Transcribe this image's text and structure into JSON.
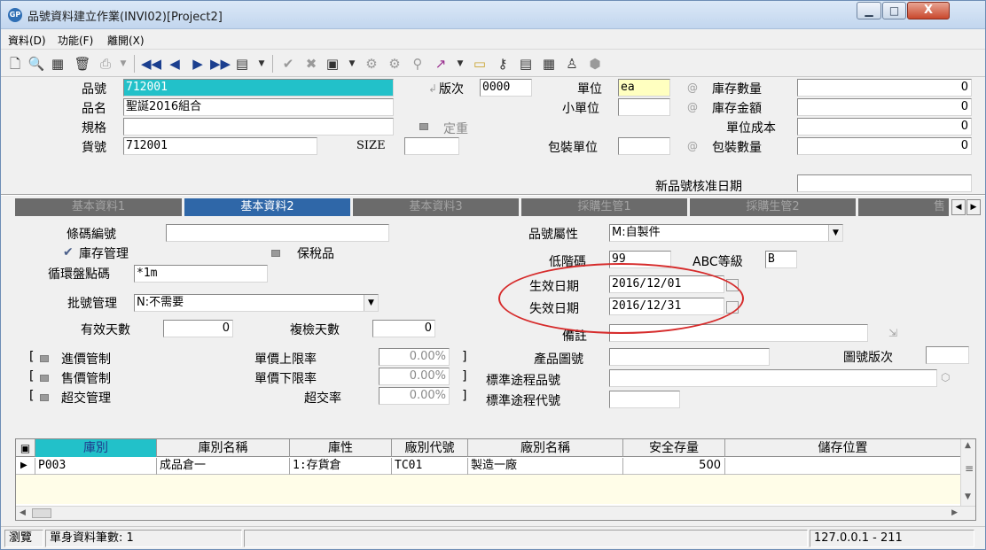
{
  "window": {
    "title": "品號資料建立作業(INVI02)[Project2]",
    "app_icon_text": "GP"
  },
  "menu": {
    "file": "資料(D)",
    "function": "功能(F)",
    "exit": "離開(X)"
  },
  "header": {
    "item_no_label": "品號",
    "item_no_value": "712001",
    "version_label": "版次",
    "version_value": "0000",
    "unit_label": "單位",
    "unit_value": "ea",
    "stock_qty_label": "庫存數量",
    "stock_qty_value": "0",
    "item_name_label": "品名",
    "item_name_value": "聖誕2016組合",
    "small_unit_label": "小單位",
    "small_unit_value": "",
    "stock_amount_label": "庫存金額",
    "stock_amount_value": "0",
    "spec_label": "規格",
    "spec_value": "",
    "fixed_weight_label": "定重",
    "unit_cost_label": "單位成本",
    "unit_cost_value": "0",
    "goods_no_label": "貨號",
    "goods_no_value": "712001",
    "size_label": "SIZE",
    "size_value": "",
    "pack_unit_label": "包裝單位",
    "pack_unit_value": "",
    "pack_qty_label": "包裝數量",
    "pack_qty_value": "0",
    "approve_date_label": "新品號核准日期",
    "approve_date_value": ""
  },
  "tabs": [
    {
      "label": "基本資料1"
    },
    {
      "label": "基本資料2"
    },
    {
      "label": "基本資料3"
    },
    {
      "label": "採購生管1"
    },
    {
      "label": "採購生管2"
    },
    {
      "label": "售"
    }
  ],
  "tab2": {
    "barcode_label": "條碼編號",
    "barcode_value": "",
    "inventory_mgmt_label": "庫存管理",
    "bonded_label": "保稅品",
    "cycle_count_label": "循環盤點碼",
    "cycle_count_value": "*1m",
    "lot_mgmt_label": "批號管理",
    "lot_mgmt_value": "N:不需要",
    "valid_days_label": "有效天數",
    "valid_days_value": "0",
    "recheck_days_label": "複檢天數",
    "recheck_days_value": "0",
    "purchase_ctrl_label": "進價管制",
    "sale_ctrl_label": "售價管制",
    "over_ctrl_label": "超交管理",
    "price_upper_label": "單價上限率",
    "price_upper_value": "0.00%",
    "price_lower_label": "單價下限率",
    "price_lower_value": "0.00%",
    "over_rate_label": "超交率",
    "over_rate_value": "0.00%",
    "attribute_label": "品號屬性",
    "attribute_value": "M:自製件",
    "low_level_label": "低階碼",
    "low_level_value": "99",
    "abc_label": "ABC等級",
    "abc_value": "B",
    "effective_date_label": "生效日期",
    "effective_date_value": "2016/12/01",
    "expiry_date_label": "失效日期",
    "expiry_date_value": "2016/12/31",
    "remark_label": "備註",
    "remark_value": "",
    "drawing_no_label": "產品圖號",
    "drawing_no_value": "",
    "drawing_ver_label": "圖號版次",
    "drawing_ver_value": "",
    "route_item_label": "標準途程品號",
    "route_item_value": "",
    "route_code_label": "標準途程代號",
    "route_code_value": "",
    "bracket_open": "[",
    "bracket_close": "]"
  },
  "grid": {
    "headers": [
      "庫別",
      "庫別名稱",
      "庫性",
      "廠別代號",
      "廠別名稱",
      "安全存量",
      "儲存位置"
    ],
    "rows": [
      {
        "warehouse": "P003",
        "warehouse_name": "成品倉一",
        "type": "1:存貨倉",
        "factory_code": "TC01",
        "factory_name": "製造一廠",
        "safety_stock": "500",
        "location": ""
      }
    ]
  },
  "status": {
    "mode": "瀏覽",
    "record_count": "單身資料筆數: 1",
    "server": "127.0.0.1 - 211"
  },
  "colors": {
    "active_tab": "#2f67a8",
    "highlight_field": "#22c1c9",
    "annotation_circle": "#d62b2b"
  }
}
